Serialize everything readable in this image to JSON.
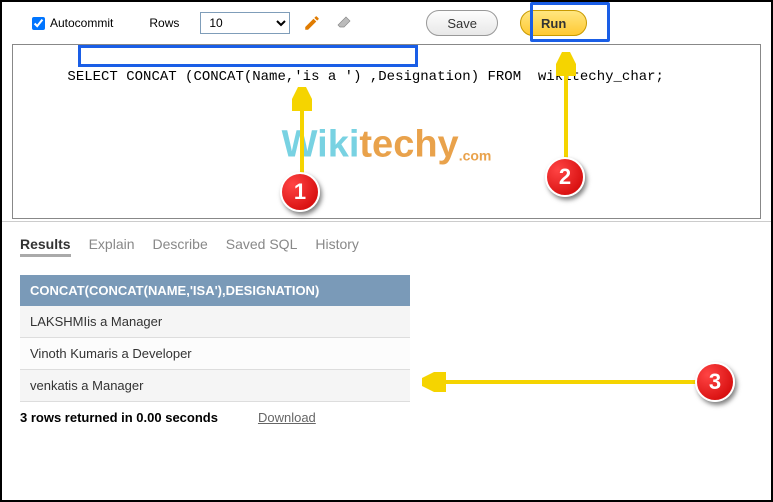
{
  "toolbar": {
    "autocommit_label": "Autocommit",
    "autocommit_checked": true,
    "rows_label": "Rows",
    "rows_value": "10",
    "save_label": "Save",
    "run_label": "Run"
  },
  "sql": {
    "part1": "SELECT ",
    "highlighted": "CONCAT (CONCAT(Name,'is a ') ,Designation)",
    "part2": " FROM  wikitechy_char;"
  },
  "watermark": {
    "brand1": "Wiki",
    "brand2": "techy",
    "suffix": ".com"
  },
  "annotations": {
    "circle1": "1",
    "circle2": "2",
    "circle3": "3"
  },
  "tabs": {
    "results": "Results",
    "explain": "Explain",
    "describe": "Describe",
    "savedsql": "Saved SQL",
    "history": "History"
  },
  "results": {
    "header": "CONCAT(CONCAT(NAME,'ISA'),DESIGNATION)",
    "rows": [
      "LAKSHMIis a Manager",
      "Vinoth Kumaris a Developer",
      "venkatis a Manager"
    ]
  },
  "status": {
    "text": "3 rows returned in 0.00 seconds",
    "download": "Download"
  }
}
